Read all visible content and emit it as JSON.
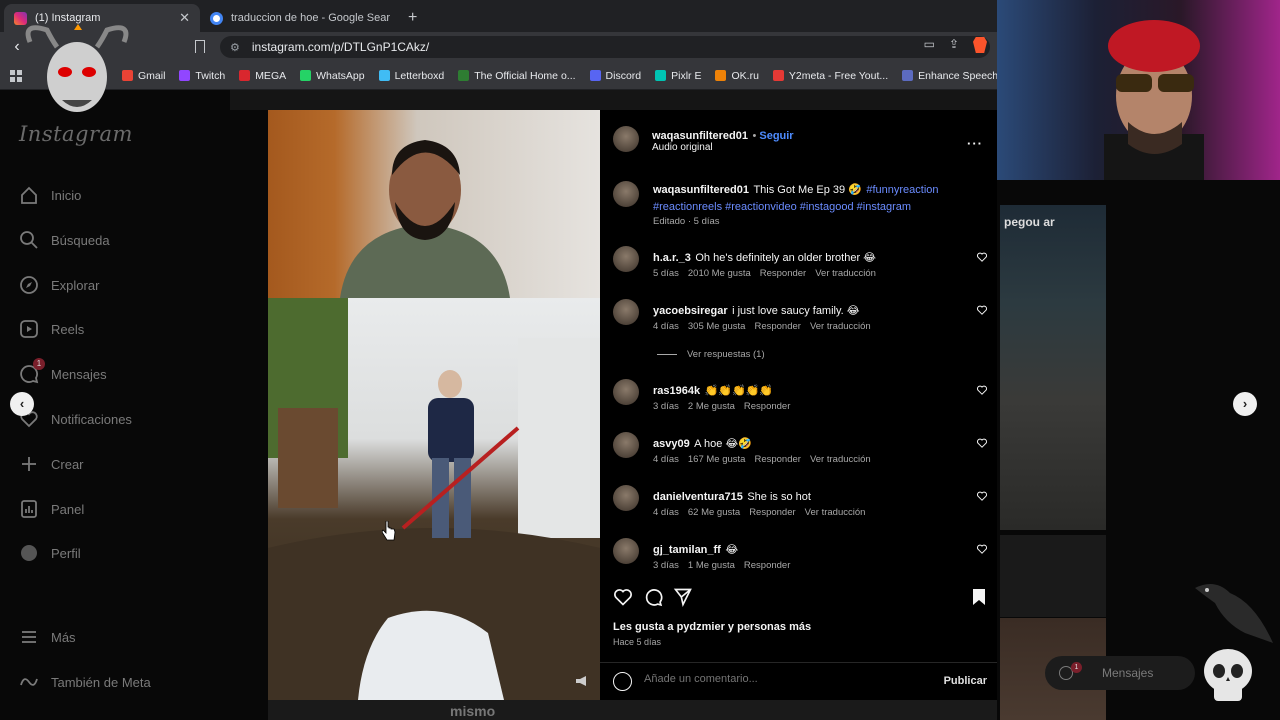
{
  "browser": {
    "tabs": [
      {
        "title": "(1) Instagram",
        "active": true,
        "favicon_color": "#e1306c"
      },
      {
        "title": "traduccion de hoe - Google Search",
        "active": false,
        "favicon_color": "#4285f4"
      }
    ],
    "url": "instagram.com/p/DTLGnP1CAkz/",
    "bookmarks": [
      {
        "label": "Gmail",
        "color": "#ea4335"
      },
      {
        "label": "Twitch",
        "color": "#9146ff"
      },
      {
        "label": "MEGA",
        "color": "#d9272e"
      },
      {
        "label": "WhatsApp",
        "color": "#25d366"
      },
      {
        "label": "Letterboxd",
        "color": "#40bcf4"
      },
      {
        "label": "The Official Home o...",
        "color": "#2e7d32"
      },
      {
        "label": "Discord",
        "color": "#5865f2"
      },
      {
        "label": "Pixlr E",
        "color": "#00c4b3"
      },
      {
        "label": "OK.ru",
        "color": "#ee8208"
      },
      {
        "label": "Y2meta - Free Yout...",
        "color": "#e53935"
      },
      {
        "label": "Enhance Speech fro...",
        "color": "#5c6bc0"
      }
    ]
  },
  "sidebar": {
    "logo": "Instagram",
    "items": [
      {
        "label": "Inicio",
        "icon": "home-icon"
      },
      {
        "label": "Búsqueda",
        "icon": "search-icon"
      },
      {
        "label": "Explorar",
        "icon": "compass-icon"
      },
      {
        "label": "Reels",
        "icon": "reels-icon"
      },
      {
        "label": "Mensajes",
        "icon": "messenger-icon",
        "badge": "1"
      },
      {
        "label": "Notificaciones",
        "icon": "heart-icon"
      },
      {
        "label": "Crear",
        "icon": "plus-icon"
      },
      {
        "label": "Panel",
        "icon": "dashboard-icon"
      },
      {
        "label": "Perfil",
        "icon": "profile-icon"
      },
      {
        "label": "Más",
        "icon": "menu-icon"
      },
      {
        "label": "También de Meta",
        "icon": "meta-icon"
      }
    ]
  },
  "post": {
    "author": "waqasunfiltered01",
    "follow": "Seguir",
    "audio": "Audio original",
    "caption_user": "waqasunfiltered01",
    "caption_text": "This Got Me Ep 39 🤣",
    "caption_tags_1": "#funnyreaction",
    "caption_tags_2": "#reactionreels #reactionvideo #instagood #instagram",
    "caption_meta": "Editado · 5 días",
    "likes_text": "Les gusta a pydzmier y personas más",
    "time_ago": "Hace 5 días",
    "comment_placeholder": "Añade un comentario...",
    "publish": "Publicar"
  },
  "comments": [
    {
      "user": "h.a.r._3",
      "text": "Oh he's definitely an older brother 😂",
      "age": "5 días",
      "likes": "2010 Me gusta",
      "reply": "Responder",
      "translate": "Ver traducción"
    },
    {
      "user": "yacoebsiregar",
      "text": "i just love saucy family. 😂",
      "age": "4 días",
      "likes": "305 Me gusta",
      "reply": "Responder",
      "translate": "Ver traducción",
      "replies": "Ver respuestas (1)"
    },
    {
      "user": "ras1964k",
      "text": "👏👏👏👏👏",
      "age": "3 días",
      "likes": "2 Me gusta",
      "reply": "Responder",
      "translate": ""
    },
    {
      "user": "asvy09",
      "text": "A hoe 😂🤣",
      "age": "4 días",
      "likes": "167 Me gusta",
      "reply": "Responder",
      "translate": "Ver traducción"
    },
    {
      "user": "danielventura715",
      "text": "She is so hot",
      "age": "4 días",
      "likes": "62 Me gusta",
      "reply": "Responder",
      "translate": "Ver traducción"
    },
    {
      "user": "gj_tamilan_ff",
      "text": "😂",
      "age": "3 días",
      "likes": "1 Me gusta",
      "reply": "Responder",
      "translate": ""
    }
  ],
  "background": {
    "sign_text": "pegou ar",
    "bottom_word": "mismo",
    "messages_pill": "Mensajes",
    "messages_badge": "1"
  },
  "colors": {
    "accent_link": "#6b8cff",
    "follow_blue": "#4e8cff",
    "notification_badge": "#7a1f2b"
  }
}
